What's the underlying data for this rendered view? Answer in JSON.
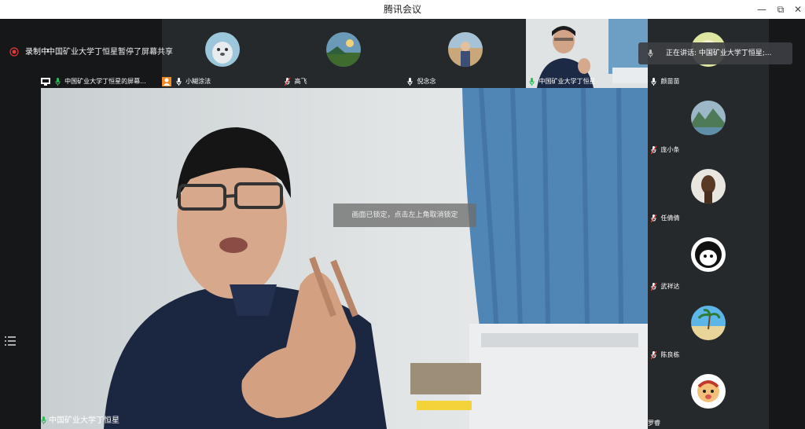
{
  "window": {
    "title": "腾讯会议",
    "minimize_icon": "—",
    "restore_icon": "⧉",
    "close_icon": "✕"
  },
  "status": {
    "recording_label": "录制中",
    "share_notice": "中国矿业大学丁恒星暂停了屏幕共享",
    "speaking_label": "正在讲话: 中国矿业大学丁恒星;..."
  },
  "lock_message": "画面已锁定，点击左上角取消锁定",
  "participants_top": [
    {
      "name": "中国矿业大学丁恒星的屏幕..."
    },
    {
      "name": "小糊涂法"
    },
    {
      "name": "高飞"
    },
    {
      "name": "倪念念"
    },
    {
      "name": "中国矿业大学丁恒星"
    }
  ],
  "participants_right": [
    {
      "name": "颜苗苗"
    },
    {
      "name": "庞小条"
    },
    {
      "name": "任倩倩"
    },
    {
      "name": "武祥达"
    },
    {
      "name": "陈良栋"
    },
    {
      "name": "罗睿"
    }
  ],
  "main_speaker": "中国矿业大学丁恒星",
  "colors": {
    "mic_active": "#2dbb58",
    "mic_muted": "#e04848",
    "record_red": "#e53935",
    "user_badge": "#f08a24"
  }
}
